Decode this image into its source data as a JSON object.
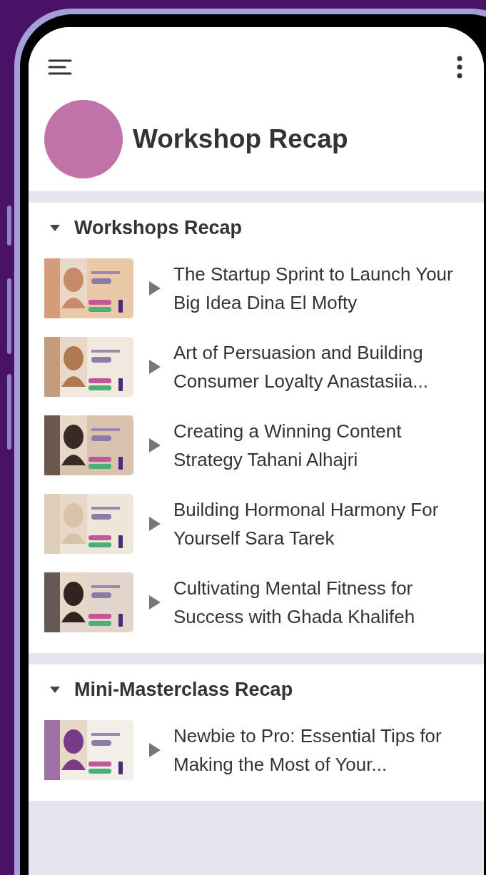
{
  "app_bar": {
    "title": "Workshop Recap"
  },
  "sections": [
    {
      "title": "Workshops Recap",
      "expanded": true,
      "items": [
        {
          "title": "The Startup Sprint to Launch Your Big Idea Dina El Mofty"
        },
        {
          "title": "Art of Persuasion and Building Consumer Loyalty Anastasiia..."
        },
        {
          "title": "Creating a Winning Content Strategy Tahani Alhajri"
        },
        {
          "title": "Building Hormonal Harmony For Yourself Sara Tarek"
        },
        {
          "title": "Cultivating Mental Fitness for Success with Ghada Khalifeh"
        }
      ]
    },
    {
      "title": "Mini-Masterclass Recap",
      "expanded": true,
      "items": [
        {
          "title": "Newbie to Pro: Essential Tips for Making the Most of Your..."
        }
      ]
    }
  ]
}
